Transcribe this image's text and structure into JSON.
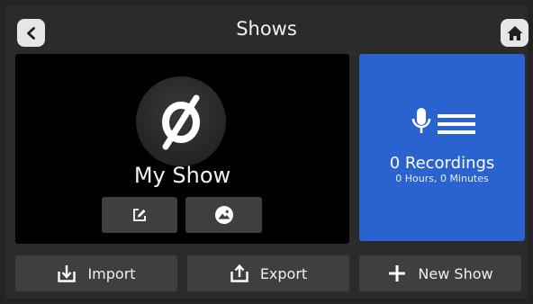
{
  "header": {
    "title": "Shows",
    "back_icon": "chevron-left-icon",
    "home_icon": "home-icon"
  },
  "show": {
    "name": "My Show",
    "logo_icon": "empty-set-icon",
    "edit_icon": "edit-icon",
    "image_icon": "image-icon"
  },
  "recordings": {
    "icon": "microphone-list-icon",
    "count_label": "0 Recordings",
    "duration_label": "0 Hours, 0 Minutes",
    "accent_color": "#2a62cf"
  },
  "footer": {
    "import_label": "Import",
    "export_label": "Export",
    "new_show_label": "New Show"
  }
}
